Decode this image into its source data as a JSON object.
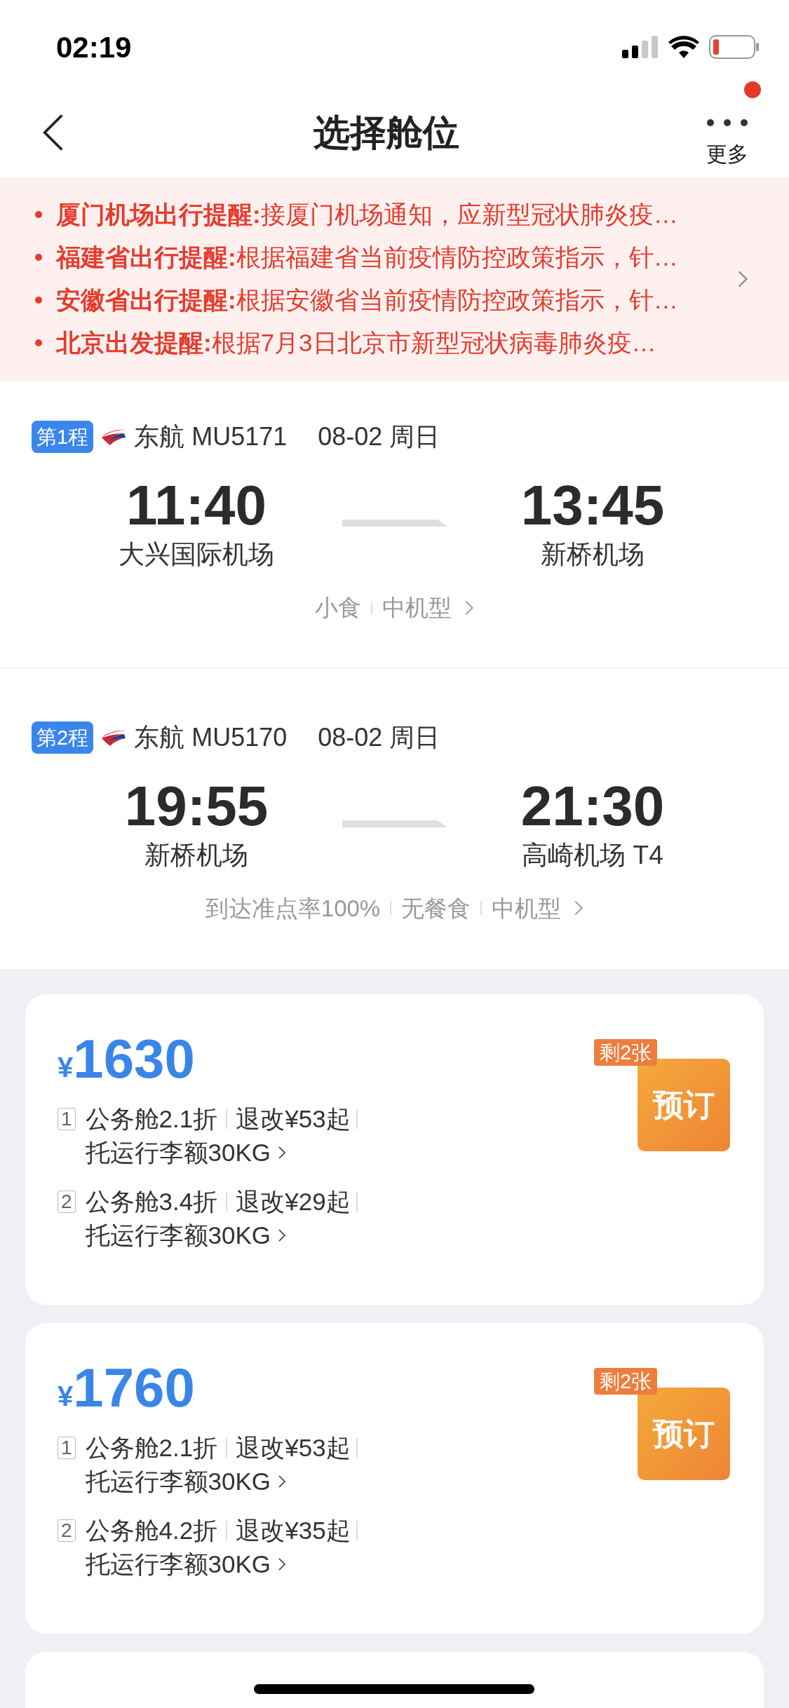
{
  "status_bar": {
    "time": "02:19"
  },
  "nav": {
    "title": "选择舱位",
    "more_label": "更多",
    "has_notification": true
  },
  "notices": [
    {
      "text": "**厦门机场出行提醒:**接厦门机场通知，应新型冠状肺炎疫…"
    },
    {
      "text": "**福建省出行提醒:**根据福建省当前疫情防控政策指示，针…"
    },
    {
      "text": "**安徽省出行提醒:**根据安徽省当前疫情防控政策指示，针…"
    },
    {
      "text": "**北京出发提醒:**根据7月3日北京市新型冠状病毒肺炎疫…"
    }
  ],
  "flights": [
    {
      "segment": "第1程",
      "airline": "东航",
      "flight_no": "MU5171",
      "date": "08-02 周日",
      "dep_time": "11:40",
      "dep_airport": "大兴国际机场",
      "arr_time": "13:45",
      "arr_airport": "新桥机场",
      "info": [
        "小食",
        "中机型"
      ]
    },
    {
      "segment": "第2程",
      "airline": "东航",
      "flight_no": "MU5170",
      "date": "08-02 周日",
      "dep_time": "19:55",
      "dep_airport": "新桥机场",
      "arr_time": "21:30",
      "arr_airport": "高崎机场 T4",
      "info": [
        "到达准点率100%",
        "无餐食",
        "中机型"
      ]
    }
  ],
  "fares": [
    {
      "currency": "¥",
      "price": "1630",
      "badge": "剩2张",
      "button": "预订",
      "options": [
        {
          "index": "1",
          "cabin": "公务舱2.1折",
          "refund": "退改¥53起",
          "baggage": "托运行李额30KG"
        },
        {
          "index": "2",
          "cabin": "公务舱3.4折",
          "refund": "退改¥29起",
          "baggage": "托运行李额30KG"
        }
      ]
    },
    {
      "currency": "¥",
      "price": "1760",
      "badge": "剩2张",
      "button": "预订",
      "options": [
        {
          "index": "1",
          "cabin": "公务舱2.1折",
          "refund": "退改¥53起",
          "baggage": "托运行李额30KG"
        },
        {
          "index": "2",
          "cabin": "公务舱4.2折",
          "refund": "退改¥35起",
          "baggage": "托运行李额30KG"
        }
      ]
    }
  ]
}
